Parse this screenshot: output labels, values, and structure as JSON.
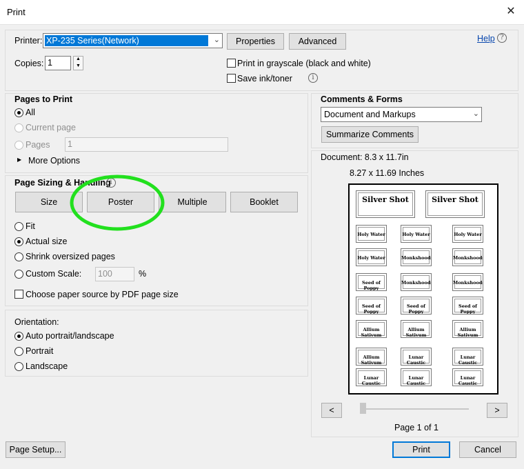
{
  "window": {
    "title": "Print",
    "close_glyph": "✕"
  },
  "printer": {
    "label": "Printer:",
    "selected": "XP-235 Series(Network)",
    "properties_label": "Properties",
    "advanced_label": "Advanced",
    "help_label": "Help",
    "copies_label": "Copies:",
    "copies_value": "1",
    "grayscale_label": "Print in grayscale (black and white)",
    "save_ink_label": "Save ink/toner"
  },
  "pages_to_print": {
    "heading": "Pages to Print",
    "all_label": "All",
    "current_page_label": "Current page",
    "pages_label": "Pages",
    "pages_value": "1",
    "more_options_label": "More Options"
  },
  "page_sizing": {
    "heading": "Page Sizing & Handling",
    "tabs": [
      "Size",
      "Poster",
      "Multiple",
      "Booklet"
    ],
    "fit_label": "Fit",
    "actual_size_label": "Actual size",
    "shrink_label": "Shrink oversized pages",
    "custom_scale_label": "Custom Scale:",
    "custom_scale_value": "100",
    "percent_label": "%",
    "paper_source_label": "Choose paper source by PDF page size"
  },
  "orientation": {
    "heading": "Orientation:",
    "auto_label": "Auto portrait/landscape",
    "portrait_label": "Portrait",
    "landscape_label": "Landscape"
  },
  "comments_forms": {
    "heading": "Comments & Forms",
    "selected": "Document and Markups",
    "summarize_label": "Summarize Comments"
  },
  "preview": {
    "document_size": "Document: 8.3 x 11.7in",
    "paper_size": "8.27 x 11.69 Inches",
    "prev_glyph": "<",
    "next_glyph": ">",
    "page_info": "Page 1 of 1",
    "big_cards": [
      "Silver Shot",
      "Silver Shot"
    ],
    "grid_labels": [
      [
        "Holy Water",
        "Holy Water",
        "Holy Water"
      ],
      [
        "Holy Water",
        "Monkshoods",
        "Monkshoods"
      ],
      [
        "Seed of Poppy",
        "Monkshoods",
        "Monkshoods"
      ],
      [
        "Seed of Poppy",
        "Seed of Poppy",
        "Seed of Poppy"
      ],
      [
        "Allium Sativum",
        "Allium Sativum",
        "Allium Sativum"
      ],
      [
        "Allium Sativum",
        "Lunar Caustic",
        "Lunar Caustic"
      ],
      [
        "Lunar Caustic",
        "Lunar Caustic",
        "Lunar Caustic"
      ]
    ]
  },
  "footer": {
    "page_setup_label": "Page Setup...",
    "print_label": "Print",
    "cancel_label": "Cancel"
  },
  "annotation": {
    "color": "#22e01e"
  }
}
